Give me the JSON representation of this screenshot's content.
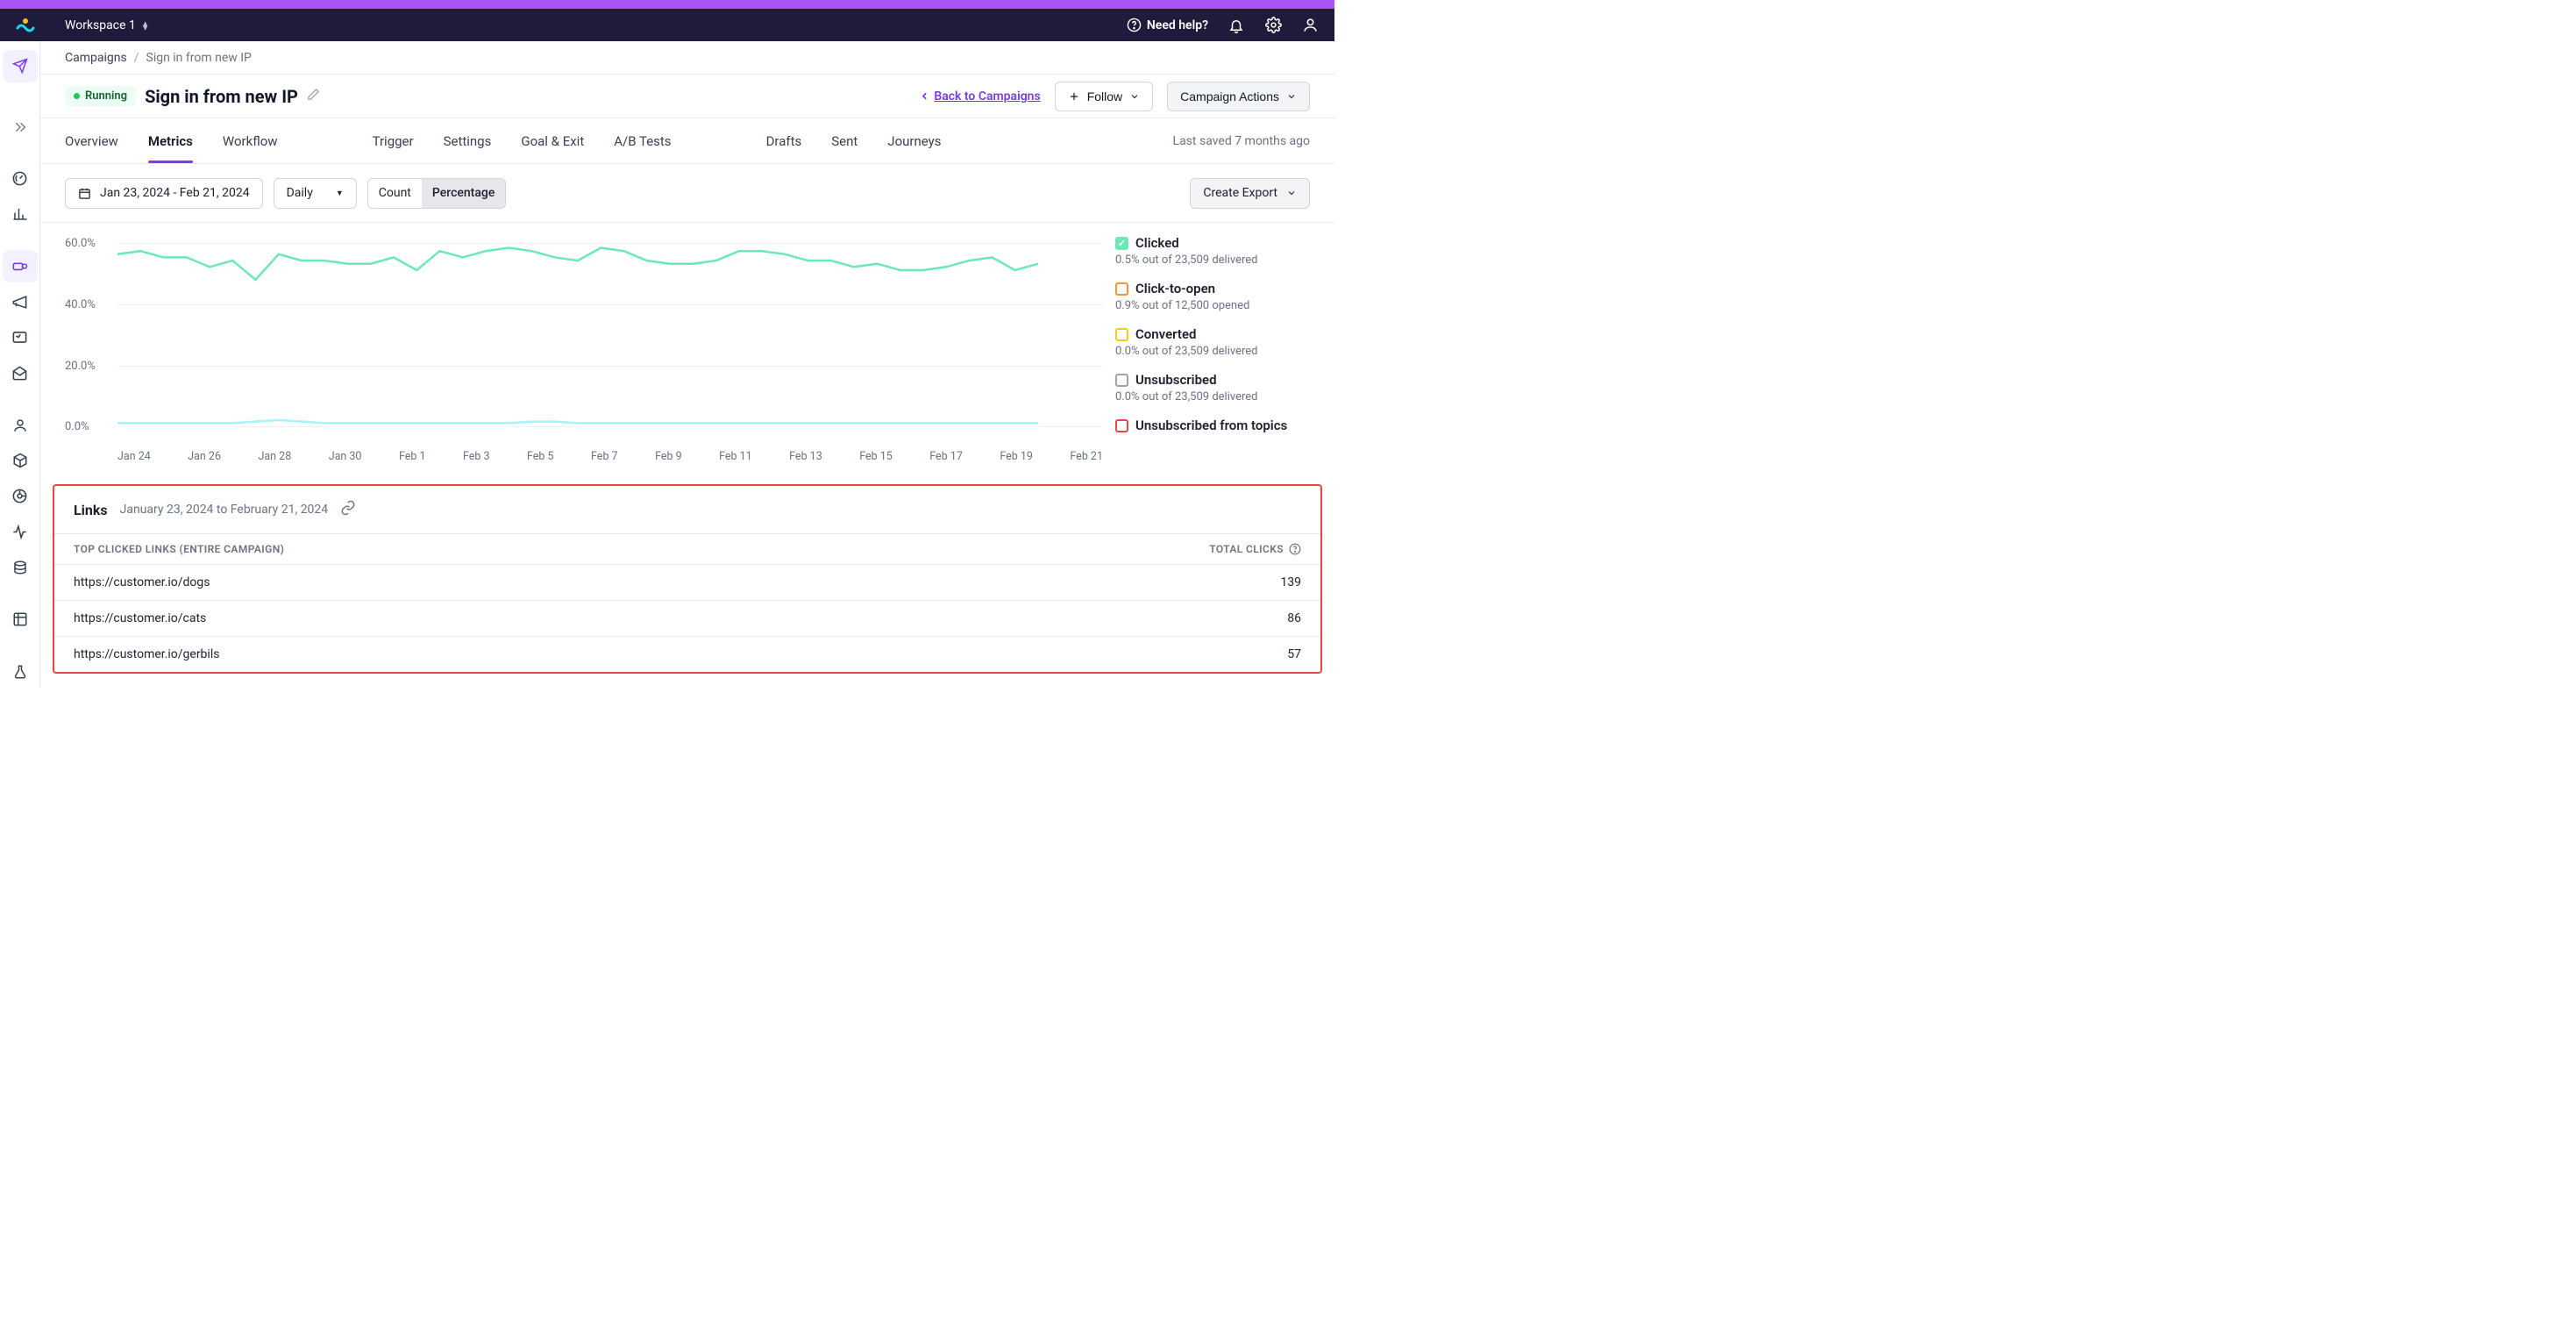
{
  "topbar": {
    "workspace": "Workspace 1",
    "help": "Need help?"
  },
  "breadcrumb": {
    "parent": "Campaigns",
    "current": "Sign in from new IP"
  },
  "header": {
    "status": "Running",
    "title": "Sign in from new IP",
    "back": "Back to Campaigns",
    "follow": "Follow",
    "actions": "Campaign Actions"
  },
  "tabs": {
    "overview": "Overview",
    "metrics": "Metrics",
    "workflow": "Workflow",
    "trigger": "Trigger",
    "settings": "Settings",
    "goal": "Goal & Exit",
    "ab": "A/B Tests",
    "drafts": "Drafts",
    "sent": "Sent",
    "journeys": "Journeys",
    "saved": "Last saved 7 months ago"
  },
  "toolbar": {
    "date_range": "Jan 23, 2024 - Feb 21, 2024",
    "interval": "Daily",
    "count": "Count",
    "percentage": "Percentage",
    "export": "Create Export"
  },
  "chart_data": {
    "type": "line",
    "ylim": [
      0,
      60
    ],
    "yticks": [
      "60.0%",
      "40.0%",
      "20.0%",
      "0.0%"
    ],
    "categories": [
      "Jan 24",
      "Jan 26",
      "Jan 28",
      "Jan 30",
      "Feb 1",
      "Feb 3",
      "Feb 5",
      "Feb 7",
      "Feb 9",
      "Feb 11",
      "Feb 13",
      "Feb 15",
      "Feb 17",
      "Feb 19",
      "Feb 21"
    ],
    "series": [
      {
        "name": "Clicked-line",
        "color": "#6ee7b7",
        "values": [
          54,
          55,
          53,
          53,
          50,
          52,
          46,
          54,
          52,
          52,
          51,
          51,
          53,
          49,
          55,
          53,
          55,
          56,
          55,
          53,
          52,
          56,
          55,
          52,
          51,
          51,
          52,
          55,
          55,
          54,
          52,
          52,
          50,
          51,
          49,
          49,
          50,
          52,
          53,
          49,
          51
        ]
      },
      {
        "name": "Converted-line",
        "color": "#a5f3fc",
        "values": [
          1,
          1,
          1,
          1,
          1,
          1,
          1.5,
          2,
          1.5,
          1,
          1,
          1,
          1,
          1,
          1,
          1,
          1,
          1,
          1.5,
          1.5,
          1,
          1,
          1,
          1,
          1,
          1,
          1,
          1,
          1,
          1,
          1,
          1,
          1,
          1,
          1,
          1,
          1,
          1,
          1,
          1,
          1
        ]
      }
    ]
  },
  "legend": [
    {
      "label": "Clicked",
      "sub": "0.5% out of 23,509 delivered",
      "color": "#6ee7b7",
      "checked": true
    },
    {
      "label": "Click-to-open",
      "sub": "0.9% out of 12,500 opened",
      "color": "#fb923c",
      "checked": false
    },
    {
      "label": "Converted",
      "sub": "0.0% out of 23,509 delivered",
      "color": "#facc15",
      "checked": false
    },
    {
      "label": "Unsubscribed",
      "sub": "0.0% out of 23,509 delivered",
      "color": "#9ca3af",
      "checked": false
    },
    {
      "label": "Unsubscribed from topics",
      "sub": "",
      "color": "#ef4444",
      "checked": false
    }
  ],
  "links": {
    "title": "Links",
    "date": "January 23, 2024 to February 21, 2024",
    "col_left": "TOP CLICKED LINKS (ENTIRE CAMPAIGN)",
    "col_right": "TOTAL CLICKS",
    "rows": [
      {
        "url": "https://customer.io/dogs",
        "count": "139"
      },
      {
        "url": "https://customer.io/cats",
        "count": "86"
      },
      {
        "url": "https://customer.io/gerbils",
        "count": "57"
      }
    ]
  }
}
